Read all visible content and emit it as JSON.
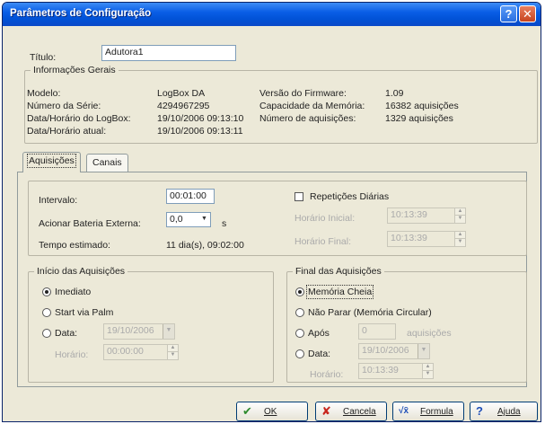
{
  "window": {
    "title": "Parâmetros de Configuração",
    "help_glyph": "?",
    "close_glyph": "✕"
  },
  "titulo": {
    "label": "Título:",
    "value": "Adutora1"
  },
  "info": {
    "group_title": "Informações Gerais",
    "modelo_label": "Modelo:",
    "modelo_value": "LogBox DA",
    "serie_label": "Número da Série:",
    "serie_value": "4294967295",
    "datalog_label": "Data/Horário do LogBox:",
    "datalog_value": "19/10/2006 09:13:10",
    "dataatual_label": "Data/Horário atual:",
    "dataatual_value": "19/10/2006 09:13:11",
    "firmware_label": "Versão do Firmware:",
    "firmware_value": "1.09",
    "capacidade_label": "Capacidade da Memória:",
    "capacidade_value": "16382 aquisições",
    "numaq_label": "Número de aquisições:",
    "numaq_value": "1329 aquisições"
  },
  "tabs": {
    "aquisicoes": "Aquisições",
    "canais": "Canais"
  },
  "aq": {
    "intervalo_label": "Intervalo:",
    "intervalo_value": "00:01:00",
    "bateria_label": "Acionar Bateria Externa:",
    "bateria_value": "0,0",
    "bateria_unit": "s",
    "tempo_label": "Tempo estimado:",
    "tempo_value": "11 dia(s), 09:02:00",
    "repeticoes_label": "Repetições Diárias",
    "hinicial_label": "Horário Inicial:",
    "hinicial_value": "10:13:39",
    "hfinal_label": "Horário Final:",
    "hfinal_value": "10:13:39"
  },
  "inicio": {
    "group_title": "Início das Aquisições",
    "imediato": "Imediato",
    "palm": "Start via Palm",
    "data_label": "Data:",
    "data_value": "19/10/2006",
    "horario_label": "Horário:",
    "horario_value": "00:00:00"
  },
  "final": {
    "group_title": "Final das Aquisições",
    "memoria": "Memória Cheia",
    "naoparar": "Não Parar (Memória Circular)",
    "apos_label": "Após",
    "apos_value": "0",
    "apos_unit": "aquisições",
    "data_label": "Data:",
    "data_value": "19/10/2006",
    "horario_label": "Horário:",
    "horario_value": "10:13:39"
  },
  "buttons": {
    "ok": "OK",
    "cancela": "Cancela",
    "formula": "Formula",
    "ajuda": "Ajuda",
    "ok_icon": "✔",
    "cancela_icon": "✘",
    "formula_icon": "√x̄",
    "ajuda_icon": "?"
  },
  "colors": {
    "title_blue": "#0a5ee6",
    "ok_green": "#2e8b2e",
    "cancel_red": "#c8261e",
    "help_blue": "#1f4fb8"
  }
}
